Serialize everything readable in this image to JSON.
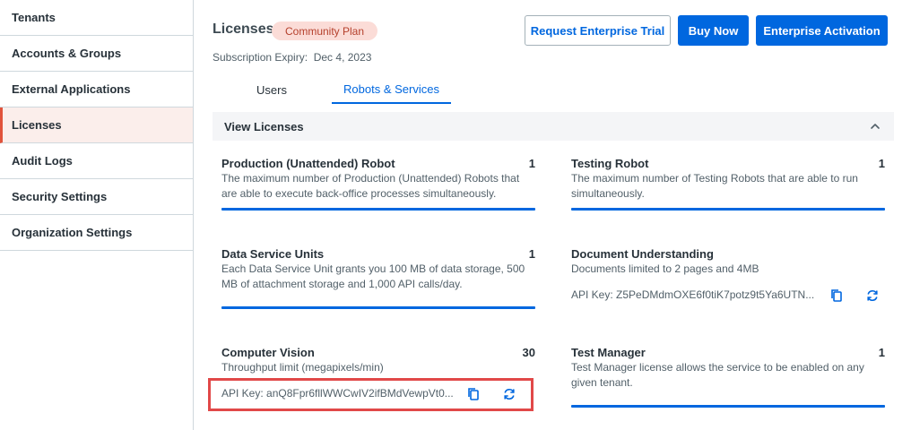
{
  "sidebar": {
    "items": [
      {
        "label": "Tenants"
      },
      {
        "label": "Accounts & Groups"
      },
      {
        "label": "External Applications"
      },
      {
        "label": "Licenses"
      },
      {
        "label": "Audit Logs"
      },
      {
        "label": "Security Settings"
      },
      {
        "label": "Organization Settings"
      }
    ],
    "active": "Licenses"
  },
  "header": {
    "title": "Licenses",
    "plan_badge": "Community Plan",
    "expiry_label": "Subscription Expiry:",
    "expiry_date": "Dec 4, 2023",
    "buttons": {
      "request_trial": "Request Enterprise Trial",
      "buy_now": "Buy Now",
      "enterprise_activation": "Enterprise Activation"
    }
  },
  "tabs": [
    {
      "label": "Users",
      "active": false
    },
    {
      "label": "Robots & Services",
      "active": true
    }
  ],
  "panel": {
    "title": "View Licenses",
    "icon": "chevron-up-icon"
  },
  "cards": {
    "production": {
      "title": "Production (Unattended) Robot",
      "count": "1",
      "desc": "The maximum number of Production (Unattended) Robots that are able to execute back-office processes simultaneously."
    },
    "testing": {
      "title": "Testing Robot",
      "count": "1",
      "desc": "The maximum number of Testing Robots that are able to run simultaneously."
    },
    "dsu": {
      "title": "Data Service Units",
      "count": "1",
      "desc": "Each Data Service Unit grants you 100 MB of data storage, 500 MB of attachment storage and 1,000 API calls/day."
    },
    "du": {
      "title": "Document Understanding",
      "desc": "Documents limited to 2 pages and 4MB",
      "api_key": "API Key: Z5PeDMdmOXE6f0tiK7potz9t5Ya6UTN..."
    },
    "cv": {
      "title": "Computer Vision",
      "count": "30",
      "desc": "Throughput limit (megapixels/min)",
      "api_key": "API Key: anQ8Fpr6fllWWCwIV2ifBMdVewpVt0..."
    },
    "test_manager": {
      "title": "Test Manager",
      "count": "1",
      "desc": "Test Manager license allows the service to be enabled on any given tenant."
    }
  },
  "colors": {
    "accent": "#0067df",
    "active_nav": "#e1533c",
    "badge_bg": "#fbdcd7",
    "highlight": "#e14848"
  }
}
